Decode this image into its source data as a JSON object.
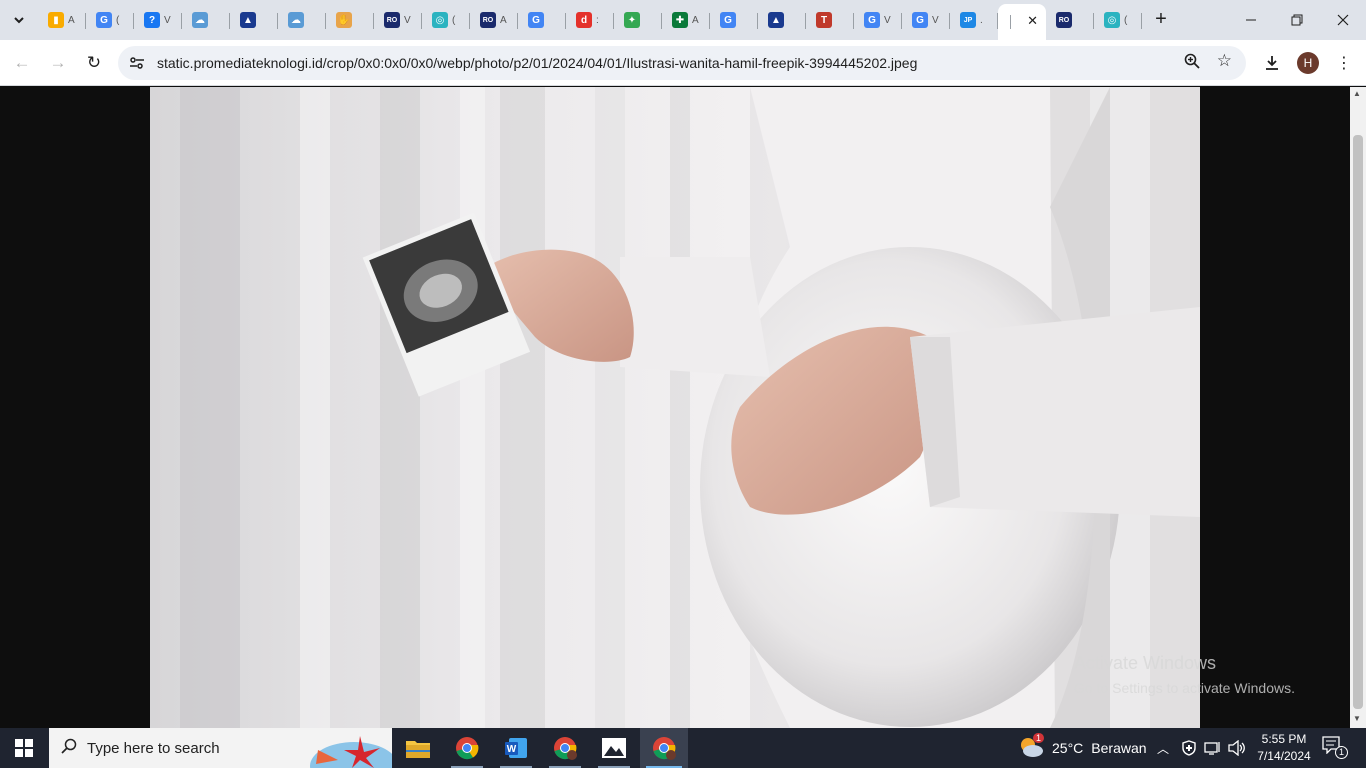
{
  "browser": {
    "tabs": [
      {
        "favicon": "google-analytics-icon",
        "color": "#f9ab00",
        "glyph": "▮",
        "title": "A"
      },
      {
        "favicon": "google-icon",
        "color": "#4285f4",
        "glyph": "G",
        "title": "("
      },
      {
        "favicon": "meta-help-icon",
        "color": "#1877f2",
        "glyph": "?",
        "title": "V"
      },
      {
        "favicon": "cloud-icon",
        "color": "#5a9bd5",
        "glyph": "☁",
        "title": ""
      },
      {
        "favicon": "feather-icon",
        "color": "#1a3a8f",
        "glyph": "▲",
        "title": ""
      },
      {
        "favicon": "cloud-icon",
        "color": "#5a9bd5",
        "glyph": "☁",
        "title": ""
      },
      {
        "favicon": "hand-icon",
        "color": "#e8a44a",
        "glyph": "✋",
        "title": ""
      },
      {
        "favicon": "ro-icon",
        "color": "#1a2a6c",
        "glyph": "RO",
        "title": "V"
      },
      {
        "favicon": "spiral-icon",
        "color": "#2bb3c0",
        "glyph": "◎",
        "title": "("
      },
      {
        "favicon": "ro-icon",
        "color": "#1a2a6c",
        "glyph": "RO",
        "title": "A"
      },
      {
        "favicon": "google-icon",
        "color": "#4285f4",
        "glyph": "G",
        "title": ""
      },
      {
        "favicon": "detik-icon",
        "color": "#e4312b",
        "glyph": "d",
        "title": ":"
      },
      {
        "favicon": "puzzle-icon",
        "color": "#34a853",
        "glyph": "✦",
        "title": ""
      },
      {
        "favicon": "cross-icon",
        "color": "#0a7a3a",
        "glyph": "✚",
        "title": "A"
      },
      {
        "favicon": "google-icon",
        "color": "#4285f4",
        "glyph": "G",
        "title": ""
      },
      {
        "favicon": "feather-icon",
        "color": "#1a3a8f",
        "glyph": "▲",
        "title": ""
      },
      {
        "favicon": "t-icon",
        "color": "#c0392b",
        "glyph": "T",
        "title": ""
      },
      {
        "favicon": "google-icon",
        "color": "#4285f4",
        "glyph": "G",
        "title": "V"
      },
      {
        "favicon": "google-icon",
        "color": "#4285f4",
        "glyph": "G",
        "title": "V"
      },
      {
        "favicon": "jp-icon",
        "color": "#1e88e5",
        "glyph": "JP",
        "title": "."
      },
      {
        "favicon": "image-tab",
        "color": "#ffffff",
        "glyph": "",
        "title": "",
        "active": true
      },
      {
        "favicon": "ro-icon",
        "color": "#1a2a6c",
        "glyph": "RO",
        "title": ""
      },
      {
        "favicon": "spiral-icon",
        "color": "#2bb3c0",
        "glyph": "◎",
        "title": "("
      }
    ],
    "url": "static.promediateknologi.id/crop/0x0:0x0/0x0/webp/photo/p2/01/2024/04/01/Ilustrasi-wanita-hamil-freepik-3994445202.jpeg",
    "profile_initial": "H"
  },
  "watermark": {
    "line1": "Activate Windows",
    "line2": "Go to Settings to activate Windows."
  },
  "taskbar": {
    "search_placeholder": "Type here to search",
    "weather_temp": "25°C",
    "weather_text": "Berawan",
    "weather_badge": "1",
    "time": "5:55 PM",
    "date": "7/14/2024",
    "notification_count": "1"
  }
}
